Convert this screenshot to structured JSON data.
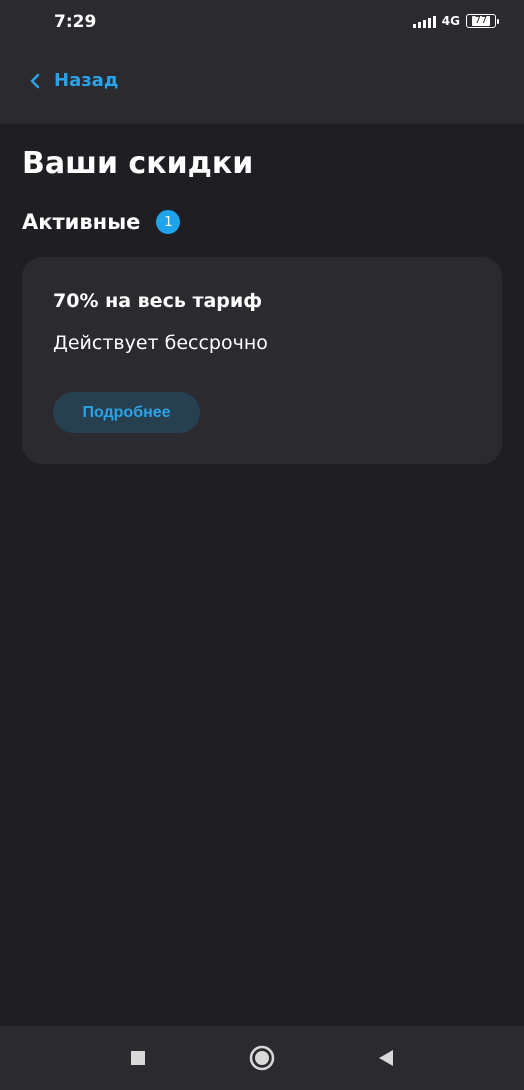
{
  "status_bar": {
    "time": "7:29",
    "network": "4G",
    "battery": "77"
  },
  "header": {
    "back_label": "Назад",
    "back_icon": "chevron-left-icon"
  },
  "page": {
    "title": "Ваши скидки"
  },
  "section": {
    "title": "Активные",
    "count": "1"
  },
  "discounts": [
    {
      "title": "70% на весь тариф",
      "subtitle": "Действует бессрочно",
      "button_label": "Подробнее"
    }
  ],
  "nav": {
    "recent_icon": "square-icon",
    "home_icon": "circle-icon",
    "back_icon": "triangle-back-icon"
  },
  "colors": {
    "background": "#1e1e23",
    "surface": "#2a2a2f",
    "accent": "#2aa3e8",
    "button_bg": "#26404f"
  }
}
